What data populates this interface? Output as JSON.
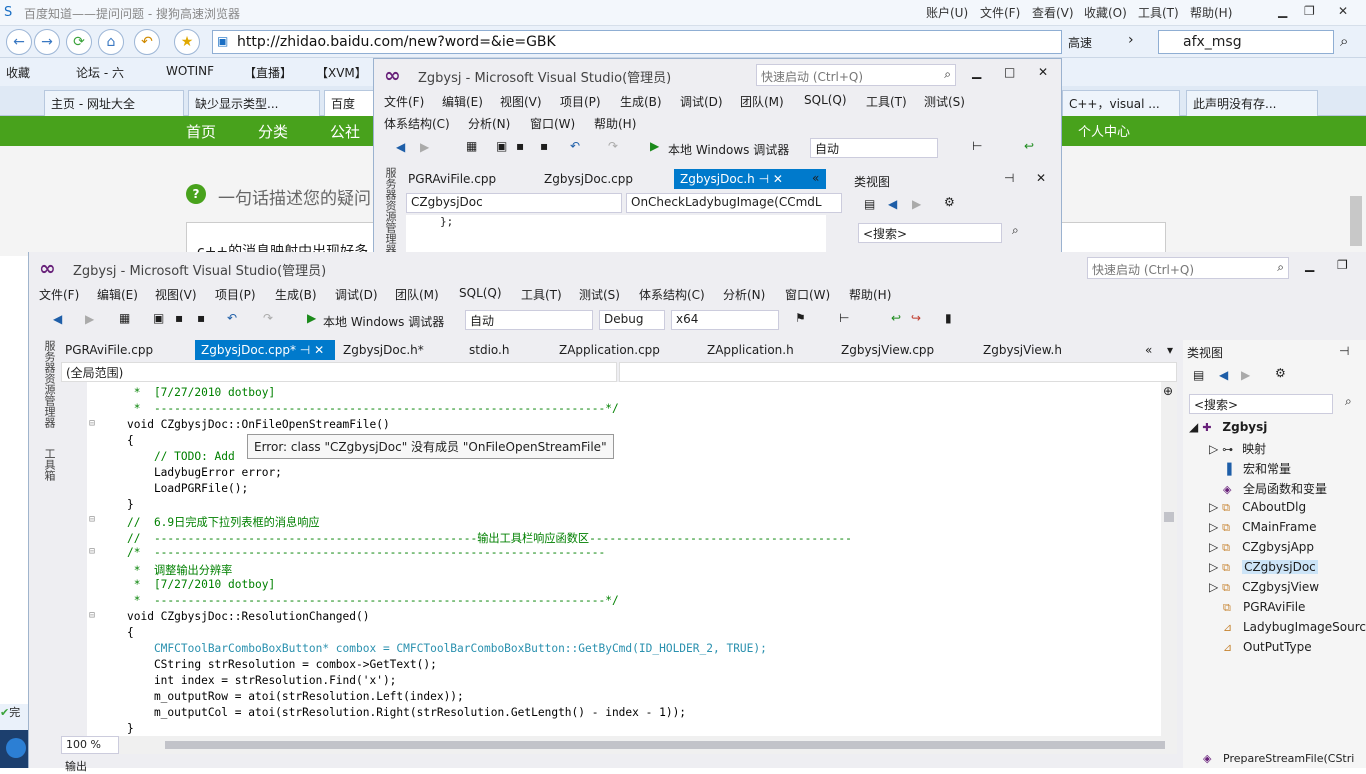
{
  "browser": {
    "title": "百度知道——提问问题 - 搜狗高速浏览器",
    "menu": [
      "账户(U)",
      "文件(F)",
      "查看(V)",
      "收藏(O)",
      "工具(T)",
      "帮助(H)"
    ],
    "url": "http://zhidao.baidu.com/new?word=&ie=GBK",
    "speed_label": "高速",
    "search_value": "afx_msg",
    "bookmarks": [
      "收藏",
      "论坛 - 六",
      "WOTINF",
      "【直播】",
      "【XVM】"
    ],
    "tabs": [
      "主页 - 网址大全",
      "缺少显示类型...",
      "百度",
      "C++，visual ...",
      "此声明没有存..."
    ],
    "green_nav": [
      "首页",
      "分类",
      "公社",
      "个人中心"
    ],
    "question_prompt": "一句话描述您的疑问",
    "content_snippet": "c++的消息映射中出现好多",
    "status_snip": "完"
  },
  "vs_back": {
    "title": "Zgbysj - Microsoft Visual Studio(管理员)",
    "quick_launch": "快速启动 (Ctrl+Q)",
    "menu_row1": [
      "文件(F)",
      "编辑(E)",
      "视图(V)",
      "项目(P)",
      "生成(B)",
      "调试(D)",
      "团队(M)",
      "SQL(Q)",
      "工具(T)",
      "测试(S)"
    ],
    "menu_row2": [
      "体系结构(C)",
      "分析(N)",
      "窗口(W)",
      "帮助(H)"
    ],
    "debug_label": "本地 Windows 调试器",
    "config": "自动",
    "tabs": [
      "PGRAviFile.cpp",
      "ZgbysjDoc.cpp",
      "ZgbysjDoc.h"
    ],
    "active_tab": "ZgbysjDoc.h",
    "class_combo": "CZgbysjDoc",
    "member_combo": "OnCheckLadybugImage(CCmdL",
    "code_line": "};",
    "class_view_title": "类视图",
    "search_placeholder": "<搜索>",
    "side_label": "服务器资源管理器"
  },
  "vs_front": {
    "title": "Zgbysj - Microsoft Visual Studio(管理员)",
    "quick_launch": "快速启动 (Ctrl+Q)",
    "menu": [
      "文件(F)",
      "编辑(E)",
      "视图(V)",
      "项目(P)",
      "生成(B)",
      "调试(D)",
      "团队(M)",
      "SQL(Q)",
      "工具(T)",
      "测试(S)",
      "体系结构(C)",
      "分析(N)",
      "窗口(W)",
      "帮助(H)"
    ],
    "debug_label": "本地 Windows 调试器",
    "config": "自动",
    "build": "Debug",
    "platform": "x64",
    "tabs": [
      "PGRAviFile.cpp",
      "ZgbysjDoc.cpp*",
      "ZgbysjDoc.h*",
      "stdio.h",
      "ZApplication.cpp",
      "ZApplication.h",
      "ZgbysjView.cpp",
      "ZgbysjView.h"
    ],
    "active_tab": "ZgbysjDoc.cpp*",
    "scope": "(全局范围)",
    "side_labels": [
      "服务器资源管理器",
      "工具箱"
    ],
    "zoom": "100 %",
    "output_label": "输出",
    "tooltip": "Error: class \"CZgbysjDoc\" 没有成员 \"OnFileOpenStreamFile\"",
    "code": [
      " *  [7/27/2010 dotboy]",
      " *  -------------------------------------------------------------------*/",
      "void CZgbysjDoc::OnFileOpenStreamFile()",
      "{",
      "    // TODO: Add",
      "    LadybugError error;",
      "    LoadPGRFile();",
      "}",
      "//  6.9日完成下拉列表框的消息响应",
      "//  ------------------------------------------------输出工具栏响应函数区---------------------------------------",
      "/*  -------------------------------------------------------------------",
      " *  调整输出分辨率",
      " *  [7/27/2010 dotboy]",
      " *  -------------------------------------------------------------------*/",
      "void CZgbysjDoc::ResolutionChanged()",
      "{",
      "    CMFCToolBarComboBoxButton* combox = CMFCToolBarComboBoxButton::GetByCmd(ID_HOLDER_2, TRUE);",
      "    CString strResolution = combox->GetText();",
      "    int index = strResolution.Find('x');",
      "    m_outputRow = atoi(strResolution.Left(index));",
      "    m_outputCol = atoi(strResolution.Right(strResolution.GetLength() - index - 1));",
      "}"
    ],
    "class_view": {
      "title": "类视图",
      "search_placeholder": "<搜索>",
      "root": "Zgbysj",
      "items": [
        "映射",
        "宏和常量",
        "全局函数和变量",
        "CAboutDlg",
        "CMainFrame",
        "CZgbysjApp",
        "CZgbysjDoc",
        "CZgbysjView",
        "PGRAviFile",
        "LadybugImageSource",
        "OutPutType"
      ],
      "selected": "CZgbysjDoc",
      "bottom_item": "PrepareStreamFile(CStri"
    }
  },
  "colors": {
    "accent": "#007acc",
    "green_nav": "#48a21c",
    "vs_bg": "#eeeef2"
  }
}
